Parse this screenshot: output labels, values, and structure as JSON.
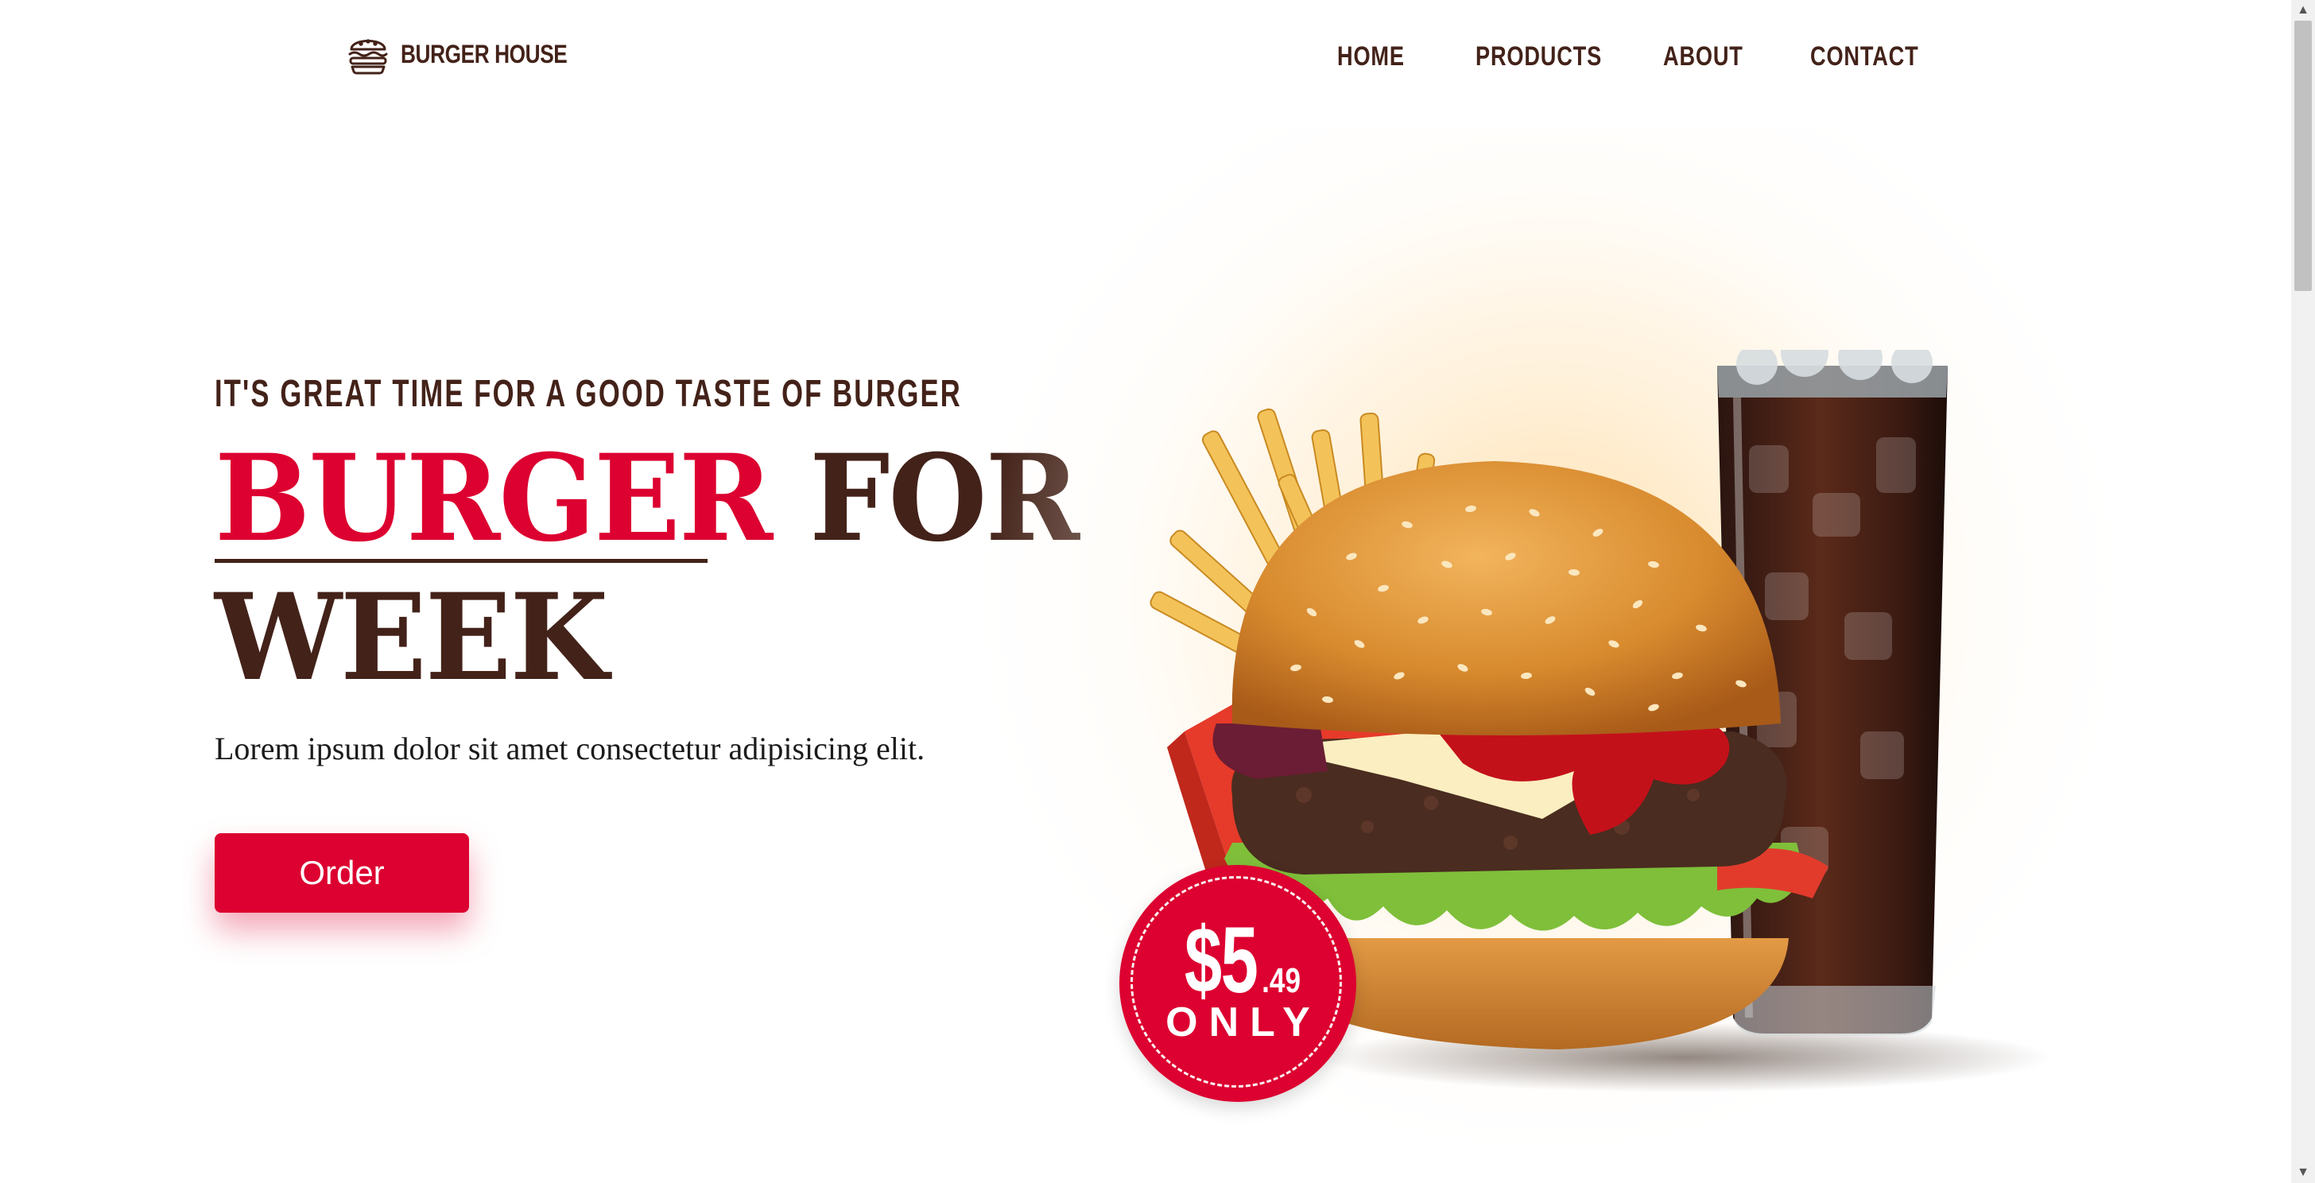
{
  "header": {
    "logo_icon": "burger-icon",
    "logo_text": "BURGER HOUSE",
    "nav": [
      {
        "label": "HOME"
      },
      {
        "label": "PRODUCTS"
      },
      {
        "label": "ABOUT"
      },
      {
        "label": "CONTACT"
      }
    ]
  },
  "hero": {
    "tagline": "IT'S GREAT TIME FOR A GOOD TASTE OF BURGER",
    "headline_accent": "BURGER",
    "headline_rest": " FOR",
    "headline_line2": "WEEK",
    "description": "Lorem ipsum dolor sit amet consectetur adipisicing elit.",
    "order_label": "Order",
    "price": {
      "dollars": "$5",
      "cents": ".49",
      "only": "ONLY"
    }
  },
  "colors": {
    "brand_red": "#dc0130",
    "brand_brown": "#432219",
    "background": "#ffffff"
  },
  "icons": {
    "scroll_up": "chevron-up-icon",
    "scroll_down": "chevron-down-icon"
  }
}
